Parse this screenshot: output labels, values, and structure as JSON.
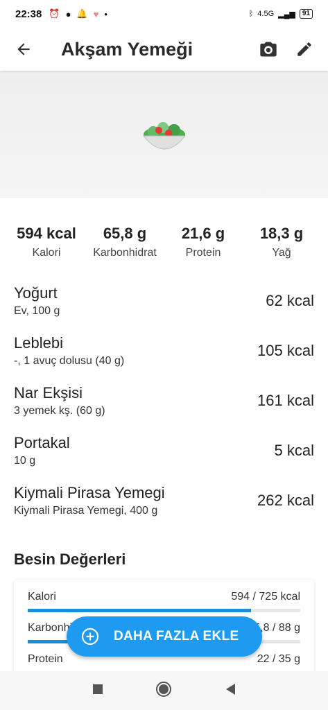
{
  "status_bar": {
    "time": "22:38",
    "network": "4.5G",
    "battery": "91"
  },
  "app_bar": {
    "title": "Akşam Yemeği",
    "back_icon": "arrow-back-icon",
    "camera_icon": "camera-icon",
    "edit_icon": "pencil-icon"
  },
  "hero": {
    "icon": "salad-bowl-icon"
  },
  "macros": [
    {
      "value": "594 kcal",
      "label": "Kalori"
    },
    {
      "value": "65,8 g",
      "label": "Karbonhidrat"
    },
    {
      "value": "21,6 g",
      "label": "Protein"
    },
    {
      "value": "18,3 g",
      "label": "Yağ"
    }
  ],
  "foods": [
    {
      "name": "Yoğurt",
      "detail": "Ev, 100 g",
      "kcal": "62 kcal"
    },
    {
      "name": "Leblebi",
      "detail": "-, 1 avuç dolusu (40 g)",
      "kcal": "105 kcal"
    },
    {
      "name": "Nar Ekşisi",
      "detail": "3 yemek kş. (60 g)",
      "kcal": "161 kcal"
    },
    {
      "name": "Portakal",
      "detail": "10 g",
      "kcal": "5 kcal"
    },
    {
      "name": "Kiymali Pirasa Yemegi",
      "detail": "Kiymali Pirasa Yemegi, 400 g",
      "kcal": "262 kcal"
    }
  ],
  "nutrients_title": "Besin Değerleri",
  "nutrients": [
    {
      "label": "Kalori",
      "value": "594 / 725 kcal",
      "progress": 0.82
    },
    {
      "label": "Karbonhidrat",
      "value": "65,8 / 88 g",
      "progress": 0.75
    },
    {
      "label": "Protein",
      "value": "22 / 35 g",
      "progress": 0.62
    }
  ],
  "fab": {
    "label": "DAHA FAZLA EKLE",
    "icon": "plus-circle-icon"
  },
  "colors": {
    "accent": "#1e9bf0",
    "progress": "#1a8fd8"
  }
}
